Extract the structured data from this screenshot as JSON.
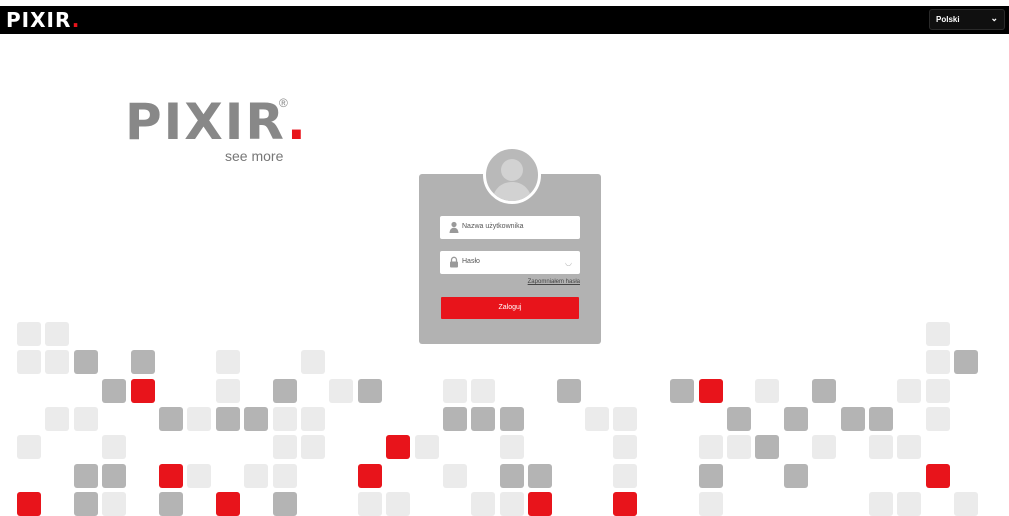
{
  "header": {
    "logo": "PIXIR",
    "logo_dot": ".",
    "language_selected": "Polski",
    "chevron_icon": "chevron-down"
  },
  "brand": {
    "logo": "PIXIR",
    "logo_dot": ".",
    "registered_mark": "®",
    "tagline": "see more"
  },
  "login": {
    "username_placeholder": "Nazwa użytkownika",
    "password_placeholder": "Hasło",
    "forgot_password": "Zapomniałem hasła",
    "submit_label": "Zaloguj",
    "icons": {
      "username": "user-icon",
      "password": "lock-icon",
      "show_password": "eye-icon"
    }
  },
  "colors": {
    "accent_red": "#e8141b",
    "header_bg": "#000000",
    "panel_gray": "#b2b2b2",
    "tile_light": "#ebebeb",
    "tile_mid": "#b4b4b4"
  }
}
